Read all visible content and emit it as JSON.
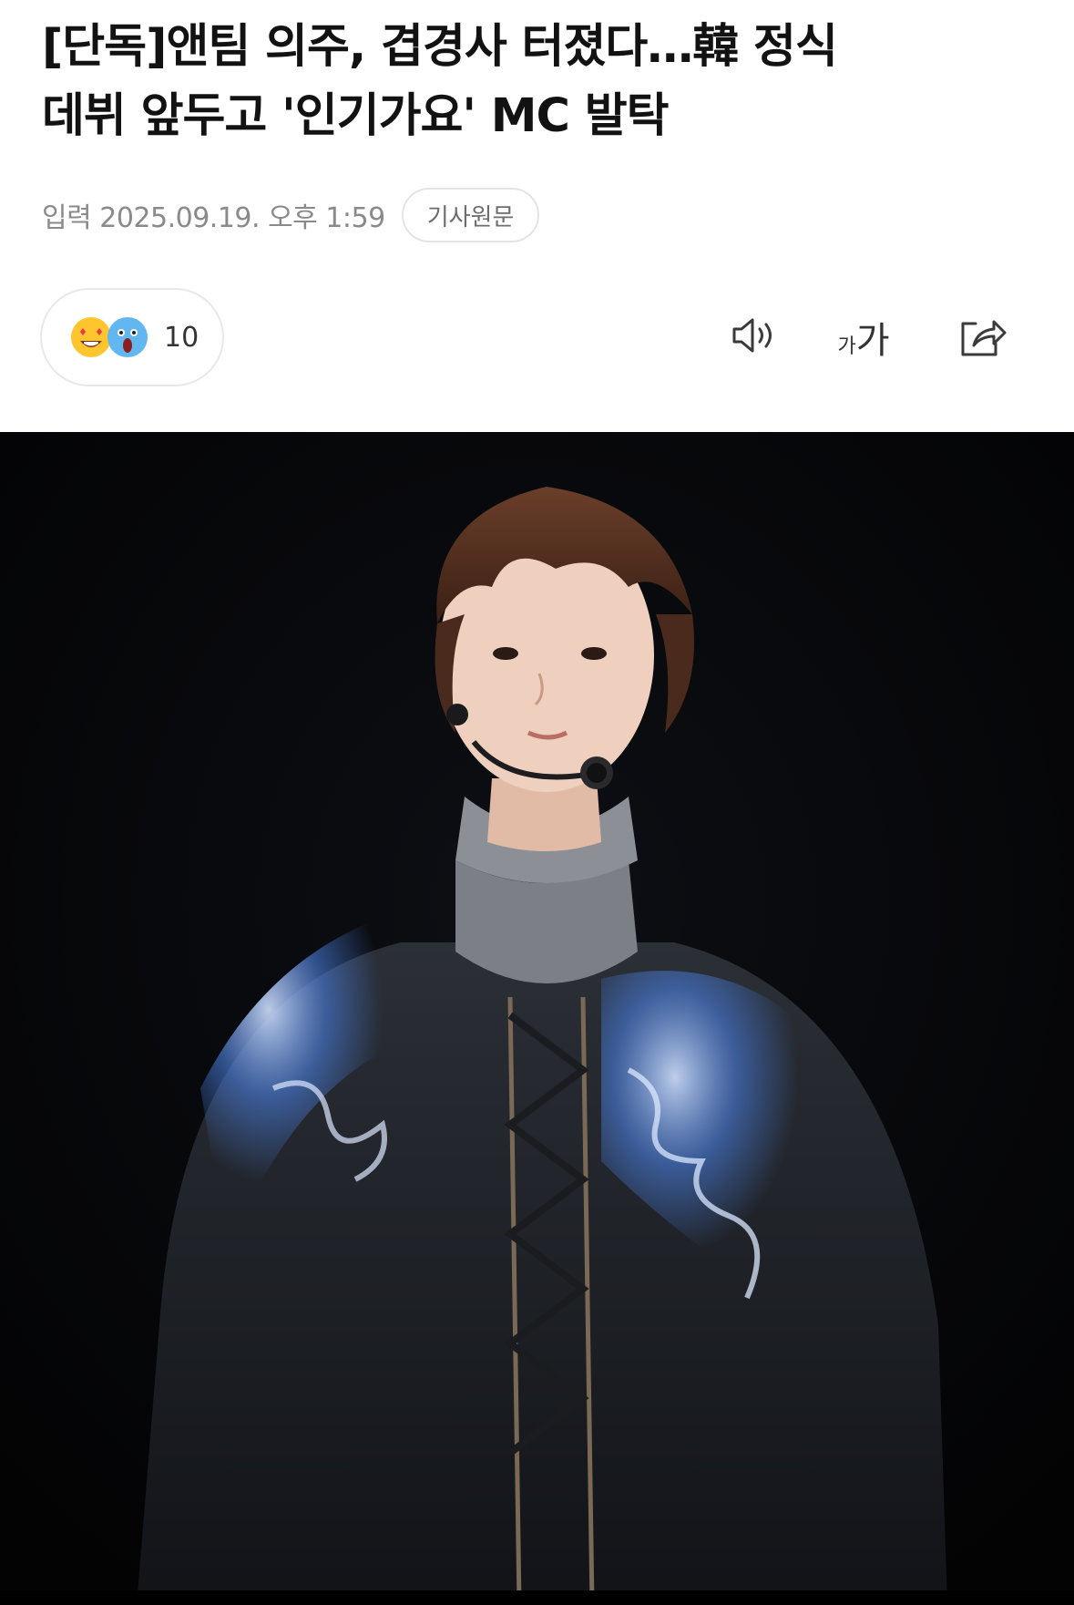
{
  "article": {
    "headline_line1": "[단독]앤팀 의주, 겹경사 터졌다…韓 정식",
    "headline_line2": "데뷔 앞두고 '인기가요' MC 발탁",
    "published": "입력 2025.09.19. 오후 1:59",
    "original_article_label": "기사원문"
  },
  "reactions": {
    "icons": [
      "heart-eyes-emoji-icon",
      "shocked-emoji-icon"
    ],
    "count": "10"
  },
  "toolbar": {
    "icons": [
      "speaker-icon",
      "font-size-icon",
      "share-icon"
    ],
    "font_small": "가",
    "font_large": "가"
  },
  "colors": {
    "photo_background": "#050608",
    "meta_text": "#8a8a8a",
    "emoji_yellow": "#ffc52e",
    "emoji_blue": "#63b7f0",
    "jacket_accent": "#4a7fe0"
  }
}
